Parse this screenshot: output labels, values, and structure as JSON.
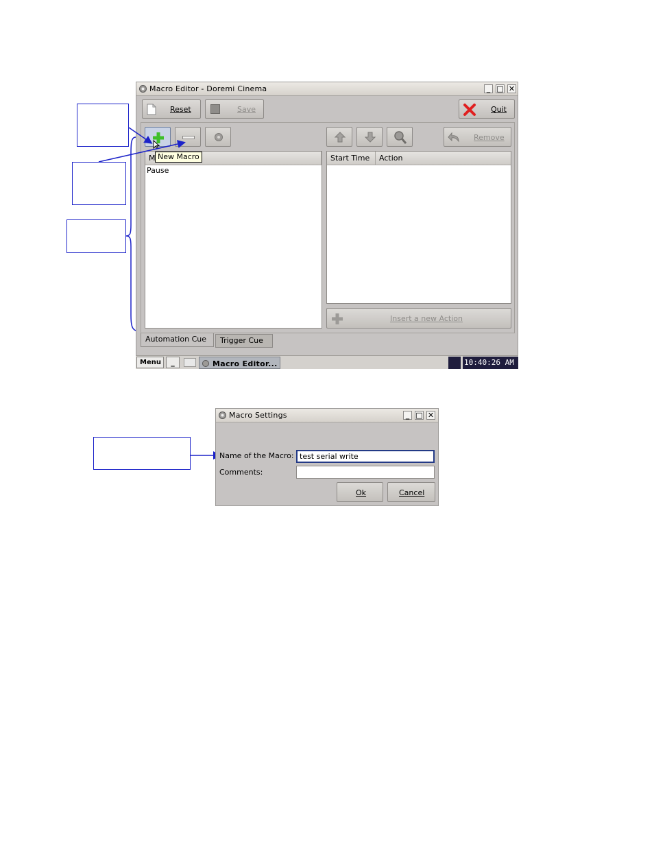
{
  "editor": {
    "title": "Macro Editor - Doremi Cinema",
    "toolbar": {
      "reset": "Reset",
      "save": "Save",
      "quit": "Quit"
    },
    "actions": {
      "remove": "Remove",
      "insert": "Insert a new Action"
    },
    "tooltip": "New Macro",
    "macro_list": {
      "column_clip": "M",
      "items": [
        "Pause"
      ]
    },
    "action_table": {
      "columns": [
        "Start Time",
        "Action"
      ]
    },
    "tabs": [
      "Automation Cue",
      "Trigger Cue"
    ]
  },
  "taskbar": {
    "menu": "Menu",
    "min_glyph": "_",
    "task": "Macro Editor...",
    "clock": "10:40:26 AM"
  },
  "settings_dialog": {
    "title": "Macro Settings",
    "name_label": "Name of the Macro:",
    "name_value": "test serial write",
    "comments_label": "Comments:",
    "comments_value": "",
    "ok": "Ok",
    "cancel": "Cancel"
  },
  "colors": {
    "annotation": "#1b22c9",
    "window_bg": "#c6c3c2",
    "add_icon": "#3fbf2a",
    "quit_icon": "#e02020"
  }
}
